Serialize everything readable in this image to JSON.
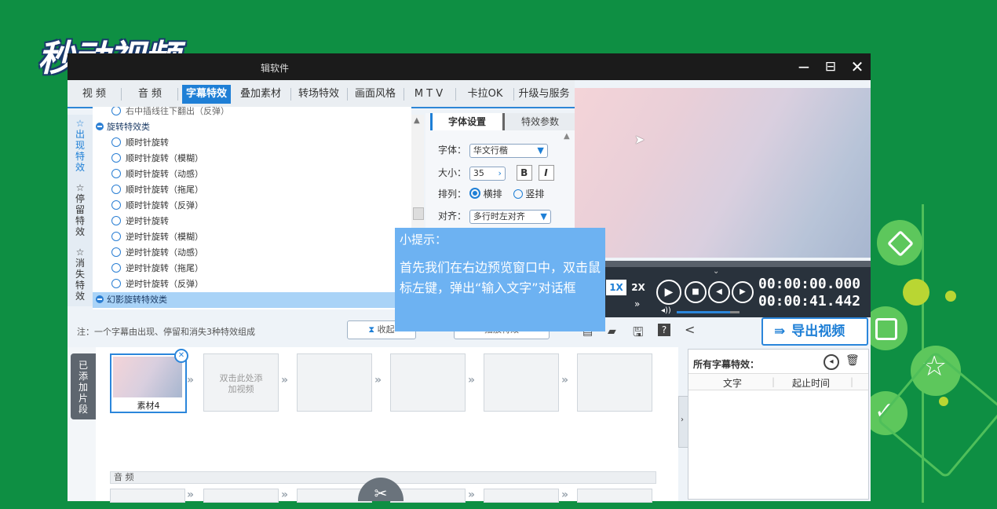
{
  "brand": {
    "logo": "秒动视频",
    "window_title": "辑软件"
  },
  "window_controls": {
    "minimize": "−",
    "maximize": "⊟",
    "close": "✕"
  },
  "tabs": [
    "视 频",
    "音 频",
    "字幕特效",
    "叠加素材",
    "转场特效",
    "画面风格",
    "M T V",
    "卡拉OK",
    "升级与服务"
  ],
  "active_tab": "字幕特效",
  "side_groups": [
    {
      "icon": "☆",
      "label": "出现特效"
    },
    {
      "icon": "☆",
      "label": "停留特效"
    },
    {
      "icon": "☆",
      "label": "消失特效"
    }
  ],
  "effects": {
    "clipped_item": "右中插线往下翻出（反弹）",
    "category1": "旋转特效类",
    "items": [
      "顺时针旋转",
      "顺时针旋转（模糊）",
      "顺时针旋转（动感）",
      "顺时针旋转（拖尾）",
      "顺时针旋转（反弹）",
      "逆时针旋转",
      "逆时针旋转（模糊）",
      "逆时针旋转（动感）",
      "逆时针旋转（拖尾）",
      "逆时针旋转（反弹）"
    ],
    "category2": "幻影旋转特效类"
  },
  "font_panel": {
    "tab_font": "字体设置",
    "tab_effect": "特效参数",
    "font_label": "字体：",
    "font_value": "华文行楷",
    "size_label": "大小：",
    "size_value": "35",
    "bold": "B",
    "italic": "I",
    "arrange_label": "排列：",
    "horizontal": "横排",
    "vertical": "竖排",
    "align_label": "对齐：",
    "align_value": "多行时左对齐"
  },
  "note": {
    "text": "注：一个字幕由出现、停留和消失3种特效组成",
    "collapse_button": "收起",
    "play_button": "播放特效"
  },
  "tip": {
    "title": "小提示：",
    "body": "首先我们在右边预览窗口中，双击鼠标左键，弹出“输入文字”对话框"
  },
  "playback": {
    "speed_1x": "1X",
    "speed_2x": "2X",
    "time_current": "00:00:00.000",
    "time_total": "00:00:41.442",
    "fast_forward": "»",
    "volume_level": 0.85
  },
  "export_button": "导出视频",
  "timeline": {
    "section_label": "已添加片段",
    "clip_name": "素材4",
    "add_hint": "双击此处添加视频",
    "audio_label": "音 频"
  },
  "subtitle_list": {
    "title": "所有字幕特效：",
    "col_text": "文字",
    "col_time": "起止时间"
  },
  "colors": {
    "accent": "#1e7fd6",
    "tip_bg": "#6db2f2",
    "background": "#0e8f43"
  }
}
